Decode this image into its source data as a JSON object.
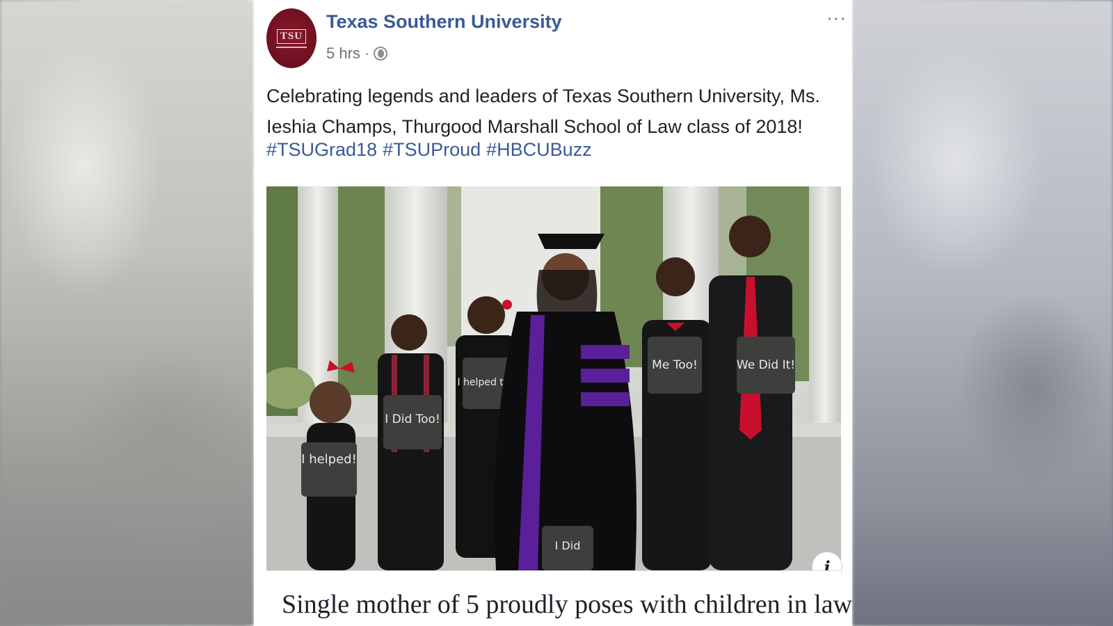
{
  "post": {
    "page_name": "Texas Southern University",
    "avatar_text": "TSU",
    "time": "5 hrs",
    "separator": "·",
    "more": "···",
    "message": "Celebrating legends and leaders of Texas Southern University, Ms. Ieshia Champs, Thurgood Marshall School of Law class of 2018!",
    "hashtags": [
      "#TSUGrad18",
      "#TSUProud",
      "#HBCUBuzz"
    ],
    "photo_signs": [
      "I helped!",
      "I Did Too!",
      "I helped too!",
      "I Did",
      "Me Too!",
      "We Did It!"
    ],
    "info": "i",
    "link_headline": "Single mother of 5 proudly poses with children in law"
  },
  "colors": {
    "page_link": "#3b5998",
    "avatar_maroon": "#7a1426",
    "text": "#1d2129",
    "meta": "#6b6f76"
  },
  "icons": {
    "globe": "globe-icon",
    "more": "more-options-icon",
    "info": "info-icon"
  }
}
